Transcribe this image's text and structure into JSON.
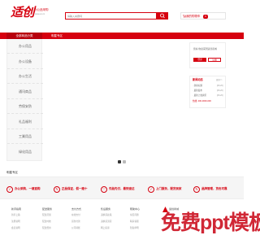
{
  "header": {
    "logo_text": "适创",
    "logo_tagline": "办公品采购",
    "logo_url": "www.sc.cn",
    "search_placeholder": "请输入关键词",
    "cart_label": "我的购物车",
    "cart_count": "0"
  },
  "nav": {
    "all_categories": "全部商品分类",
    "items": [
      "明星专区"
    ]
  },
  "categories": [
    "办公用品",
    "办公设备",
    "办公生活",
    "通讯商品",
    "劳保安防",
    "礼品福利",
    "工業用品",
    "绿化用品"
  ],
  "login": {
    "welcome": "您好!欢迎来到适创商城",
    "login_label": "登录",
    "register_label": "注册"
  },
  "news": {
    "title": "新闻动态",
    "more": "更多>>",
    "items": [
      {
        "title": "· 新闻标题",
        "date": "[08-26]"
      },
      {
        "title": "· 最新发布",
        "date": "[08-26]"
      },
      {
        "title": "· 最新上线资讯",
        "date": "[08-26]"
      }
    ],
    "phone": "热线: 400-0000-000"
  },
  "floor_title": "明星专区",
  "services": [
    {
      "icon": "✓",
      "icon_name": "check-icon",
      "text": "办公采购，一键直购"
    },
    {
      "icon": "✎",
      "icon_name": "pencil-icon",
      "text": "正品保证，假一赔十"
    },
    {
      "icon": "♡",
      "icon_name": "heart-icon",
      "text": "先验先付，最快速达"
    },
    {
      "icon": "✓",
      "icon_name": "check-icon",
      "text": "上门服务，配货到家"
    },
    {
      "icon": "✎",
      "icon_name": "pencil-icon",
      "text": "品牌管理，货色可靠"
    }
  ],
  "footer": {
    "columns": [
      {
        "heading": "新手指南",
        "links": [
          "新手上路",
          "注册说明",
          "会员说明"
        ]
      },
      {
        "heading": "配送服务",
        "links": [
          "配送范围",
          "配送时效",
          "配送费用"
        ]
      },
      {
        "heading": "支付方式",
        "links": [
          "在线支付",
          "货到付款",
          "公司转账"
        ]
      },
      {
        "heading": "售后服务",
        "links": [
          "退换货政策",
          "退换货流程",
          "网上投诉"
        ]
      },
      {
        "heading": "帮助中心",
        "links": [
          "常见问题",
          "联系客服",
          "隐私申明"
        ]
      }
    ],
    "qr_caption": "适创商城",
    "watermark": "免费ppt模板"
  },
  "colors": {
    "brand": "#d6000f",
    "nav_dark": "#b8000c",
    "panel_bg": "#f7f7f7"
  }
}
